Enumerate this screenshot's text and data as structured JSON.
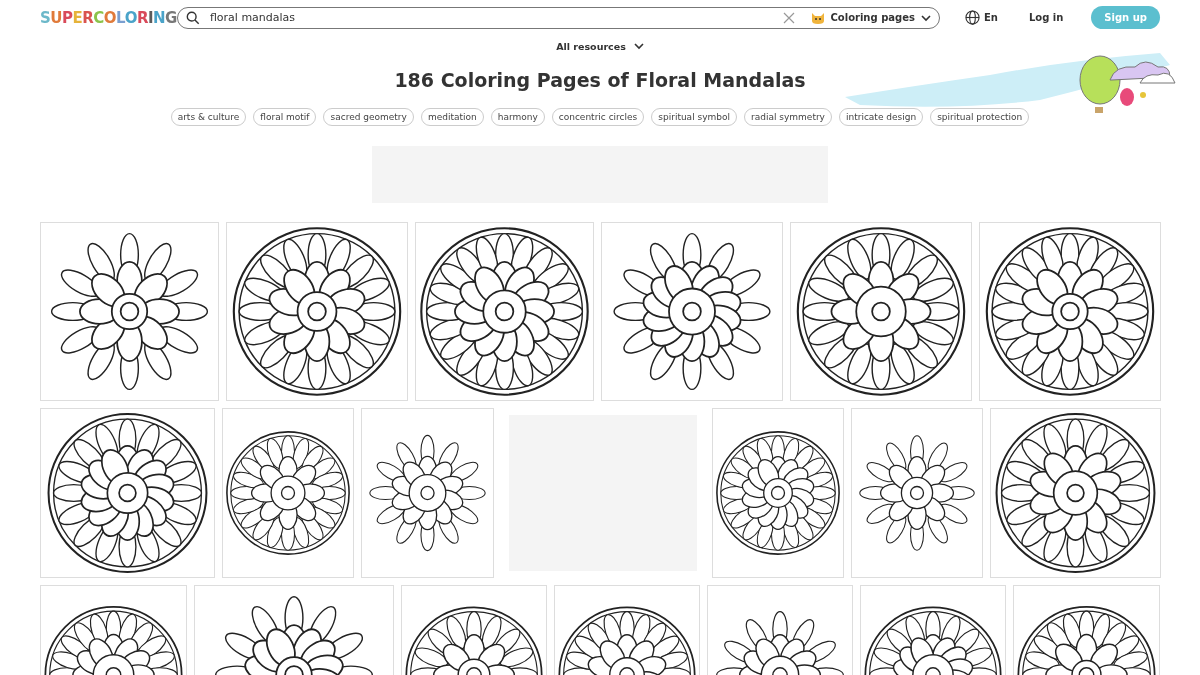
{
  "header": {
    "logo": "SUPERCOLORING",
    "search": {
      "value": "floral mandalas",
      "category": "Coloring pages"
    },
    "language": "En",
    "login": "Log in",
    "signup": "Sign up"
  },
  "resources_menu": "All resources",
  "title": "186 Coloring Pages of Floral Mandalas",
  "tags": [
    "arts & culture",
    "floral motif",
    "sacred geometry",
    "meditation",
    "harmony",
    "concentric circles",
    "spiritual symbol",
    "radial symmetry",
    "intricate design",
    "spiritual protection"
  ],
  "grid": [
    [
      {
        "kind": "picture"
      },
      {
        "kind": "picture"
      },
      {
        "kind": "picture"
      },
      {
        "kind": "picture"
      },
      {
        "kind": "picture"
      },
      {
        "kind": "picture"
      }
    ],
    [
      {
        "kind": "picture"
      },
      {
        "kind": "picture"
      },
      {
        "kind": "picture"
      },
      {
        "kind": "ad"
      },
      {
        "kind": "picture"
      },
      {
        "kind": "picture"
      },
      {
        "kind": "picture"
      }
    ],
    [
      {
        "kind": "picture"
      },
      {
        "kind": "picture"
      },
      {
        "kind": "picture"
      },
      {
        "kind": "picture"
      },
      {
        "kind": "picture"
      },
      {
        "kind": "picture"
      },
      {
        "kind": "picture"
      }
    ]
  ]
}
